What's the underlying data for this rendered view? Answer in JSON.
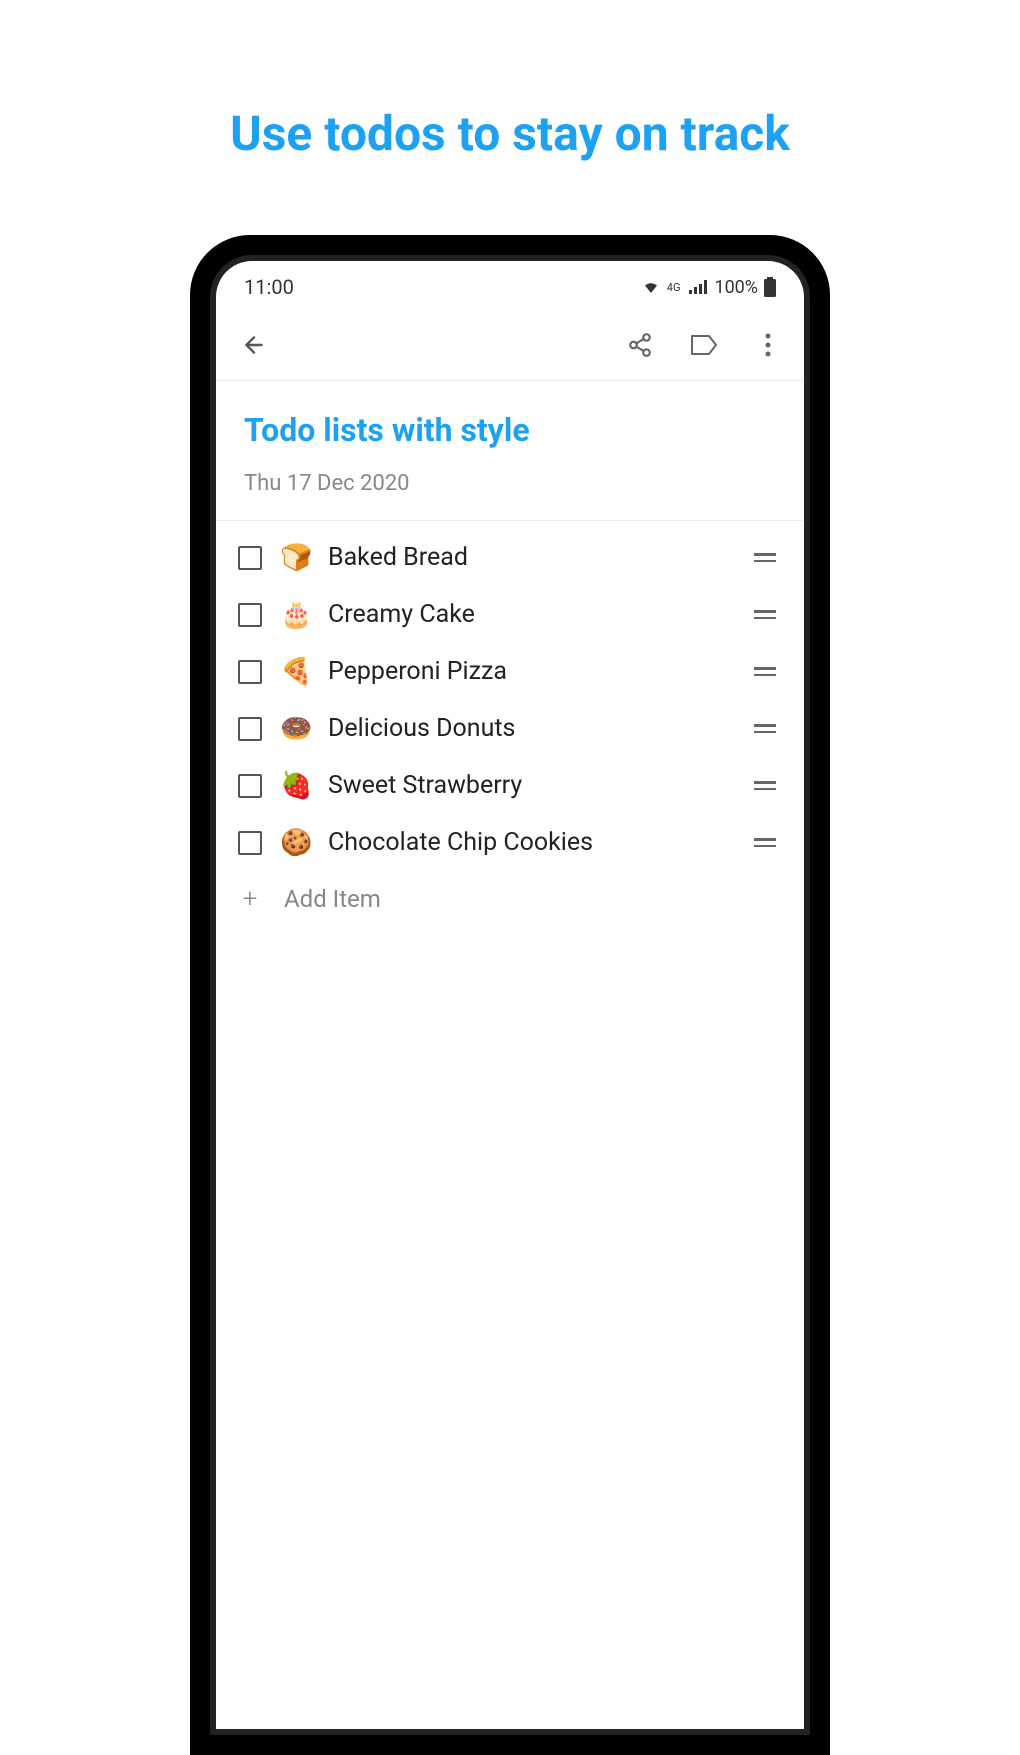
{
  "page": {
    "title": "Use todos to stay on track"
  },
  "statusBar": {
    "time": "11:00",
    "battery": "100%",
    "network": "4G"
  },
  "list": {
    "title": "Todo lists with style",
    "date": "Thu 17 Dec 2020",
    "addItemLabel": "Add Item"
  },
  "todos": [
    {
      "emoji": "🍞",
      "text": "Baked Bread"
    },
    {
      "emoji": "🎂",
      "text": "Creamy Cake"
    },
    {
      "emoji": "🍕",
      "text": "Pepperoni Pizza"
    },
    {
      "emoji": "🍩",
      "text": "Delicious Donuts"
    },
    {
      "emoji": "🍓",
      "text": "Sweet Strawberry"
    },
    {
      "emoji": "🍪",
      "text": "Chocolate Chip Cookies"
    }
  ]
}
